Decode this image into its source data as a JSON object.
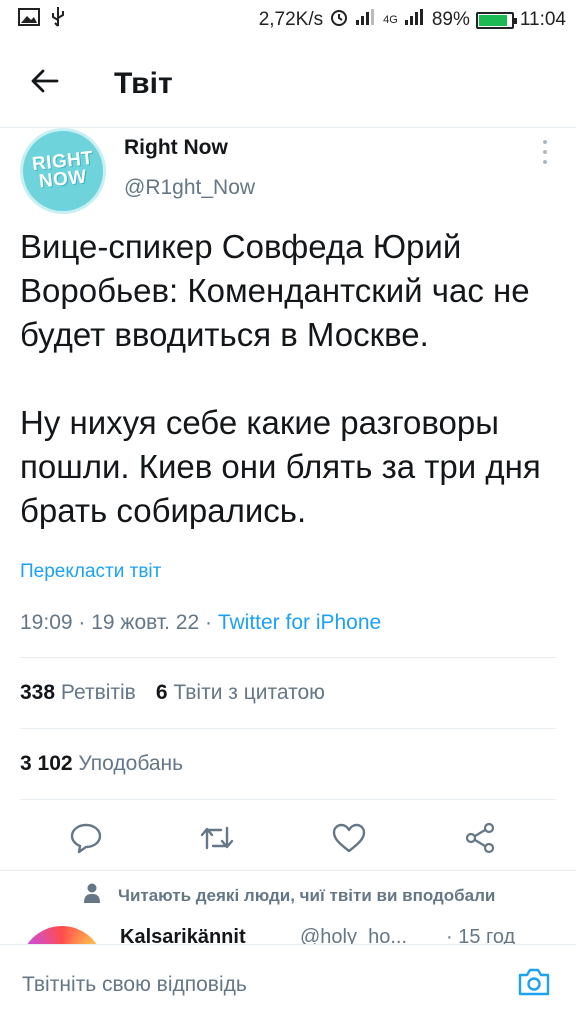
{
  "status_bar": {
    "speed": "2,72K/s",
    "net_type": "4G",
    "battery": "89%",
    "battery_level": 0.89,
    "time": "11:04",
    "icons": [
      "image-icon",
      "usb-icon",
      "alarm-icon",
      "signal-icon",
      "signal-4g-icon",
      "battery-icon"
    ]
  },
  "header": {
    "back_icon": "arrow-left-icon",
    "title": "Твіт"
  },
  "tweet": {
    "avatar_text": [
      "RIGHT",
      "NOW"
    ],
    "author_name": "Right Now",
    "author_handle": "@R1ght_Now",
    "text": "Вице-спикер Совфеда Юрий Воробьев: Комендантский час не будет вводиться в Москве.\n\nНу нихуя себе какие разговоры пошли. Киев они блять за три дня брать собирались.",
    "translate": "Перекласти твіт",
    "timestamp": "19:09 · 19 жовт. 22 · ",
    "source": "Twitter for iPhone"
  },
  "stats": {
    "retweets_count": "338",
    "retweets_label": "Ретвітів",
    "quotes_count": "6",
    "quotes_label": "Твіти з цитатою",
    "likes_count": "3 102",
    "likes_label": "Уподобань"
  },
  "actions": [
    "reply-icon",
    "retweet-icon",
    "like-icon",
    "share-icon"
  ],
  "liked_note": "Читають деякі люди, чиї твіти ви вподобали",
  "reply_peek": {
    "name": "Kalsarikännit",
    "handle": "@holy_ho...",
    "time": "· 15 год"
  },
  "reply_bar": {
    "placeholder": "Твітніть свою відповідь",
    "camera_icon": "camera-icon"
  },
  "colors": {
    "accent": "#1da1f2",
    "secondary_text": "#657786",
    "divider": "#e6ecf0",
    "avatar": "#6fd3dc"
  }
}
